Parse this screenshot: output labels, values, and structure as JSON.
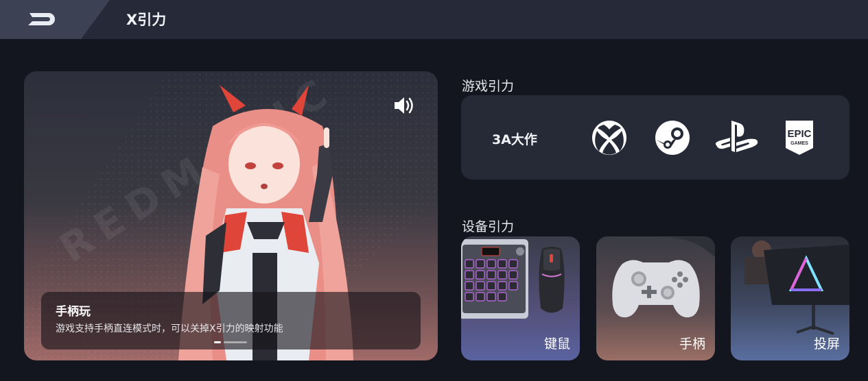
{
  "header": {
    "title": "X引力",
    "back_icon": "back-arrow-icon"
  },
  "hero": {
    "brand_watermark": "REDMAGIC",
    "sound_icon": "speaker-icon",
    "caption_title": "手柄玩",
    "caption_desc": "游戏支持手柄直连模式时，可以关掉X引力的映射功能",
    "page_count": 2,
    "active_page": 1
  },
  "games": {
    "section_title": "游戏引力",
    "category_label": "3A大作",
    "platforms": [
      {
        "name": "xbox",
        "icon": "xbox-icon"
      },
      {
        "name": "steam",
        "icon": "steam-icon"
      },
      {
        "name": "playstation",
        "icon": "playstation-icon"
      },
      {
        "name": "epic games",
        "icon": "epic-games-icon",
        "badge_top": "EPIC",
        "badge_bottom": "GAMES"
      }
    ]
  },
  "devices": {
    "section_title": "设备引力",
    "items": [
      {
        "label": "键鼠",
        "icon": "keyboard-mouse-image"
      },
      {
        "label": "手柄",
        "icon": "gamepad-image"
      },
      {
        "label": "投屏",
        "icon": "monitor-image"
      }
    ]
  },
  "colors": {
    "background": "#14161f",
    "topbar": "#262a38",
    "panel": "#262a36",
    "accent_red": "#e0453a"
  }
}
